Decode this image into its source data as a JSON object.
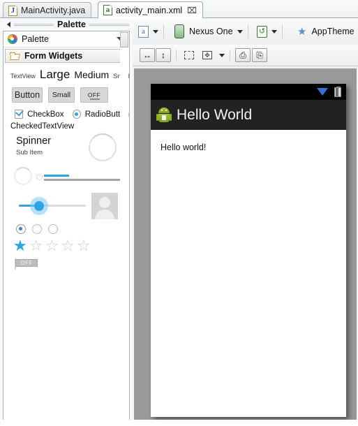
{
  "window": {
    "tabs": [
      {
        "label": "MainActivity.java",
        "icon": "java-file-icon",
        "active": false,
        "closable": false
      },
      {
        "label": "activity_main.xml",
        "icon": "xml-file-icon",
        "active": true,
        "closable": true,
        "close_glyph": "⌧"
      }
    ]
  },
  "palette": {
    "header_title": "Palette",
    "collapse_icon": "collapse-left-arrow-icon",
    "selector": {
      "label": "Palette",
      "icon": "palette-color-wheel-icon",
      "chevron": "chevron-down-icon"
    },
    "group": {
      "label": "Form Widgets",
      "icon": "open-folder-icon"
    },
    "textviews": {
      "textview": "TextView",
      "large": "Large",
      "medium": "Medium",
      "small": "Small"
    },
    "buttons": {
      "button": "Button",
      "small": "Small",
      "toggle": "OFF"
    },
    "checkbox_label": "CheckBox",
    "radiobutton_label": "RadioButton",
    "checkedtextview_label": "CheckedTextView",
    "spinner": {
      "title": "Spinner",
      "subtitle": "Sub Item"
    },
    "switch_label": "OFF",
    "star_rating": {
      "total": 5,
      "filled": 1
    },
    "radio_group": {
      "total": 3,
      "selected_index": 0
    }
  },
  "toolbar": {
    "config_icon": "xml-config-icon",
    "config_caret": "chevron-down-icon",
    "device_icon": "device-icon",
    "device_label": "Nexus One",
    "device_caret": "chevron-down-icon",
    "orientation_icon": "refresh-orientation-icon",
    "orientation_caret": "chevron-down-icon",
    "theme_icon": "star-theme-icon",
    "theme_label": "AppTheme"
  },
  "toolbar2": {
    "buttons": [
      {
        "name": "match-width-button",
        "glyph": "↔"
      },
      {
        "name": "match-height-button",
        "glyph": "↕"
      },
      {
        "name": "show-outlines-button",
        "glyph": ""
      },
      {
        "name": "zoom-to-fit-button",
        "glyph": "⤡"
      },
      {
        "name": "zoom-dropdown-caret",
        "glyph": ""
      },
      {
        "name": "distribute-button",
        "glyph": "⤷"
      },
      {
        "name": "export-button",
        "glyph": "⤴"
      }
    ]
  },
  "preview": {
    "canvas_background": "#999999",
    "statusbar": {
      "wifi_icon": "wifi-signal-icon",
      "battery_icon": "battery-icon"
    },
    "appbar": {
      "app_icon": "android-robot-icon",
      "title": "Hello World",
      "background": "#222222"
    },
    "content": {
      "text": "Hello world!"
    }
  }
}
